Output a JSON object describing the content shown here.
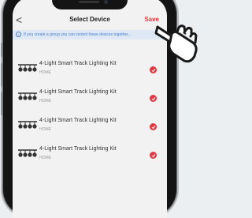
{
  "header": {
    "back_glyph": "<",
    "title": "Select Device",
    "save_label": "Save"
  },
  "info": {
    "text": "If you create a group you can control these devices together..."
  },
  "devices": [
    {
      "name": "4-Light Smart Track Lighting Kit",
      "room": "HOME",
      "selected": true
    },
    {
      "name": "4-Light Smart Track Lighting Kit",
      "room": "HOME",
      "selected": true
    },
    {
      "name": "4-Light Smart Track Lighting Kit",
      "room": "HOME",
      "selected": true
    },
    {
      "name": "4-Light Smart Track Lighting Kit",
      "room": "HOME",
      "selected": true
    }
  ],
  "colors": {
    "accent": "#e8393f",
    "check": "#e03a45",
    "info_bg": "#dfe9f6",
    "info_text": "#4a7cc4"
  },
  "icons": {
    "device": "track-light-icon",
    "selected": "check-circle-icon",
    "pointer": "pointing-hand-icon"
  }
}
